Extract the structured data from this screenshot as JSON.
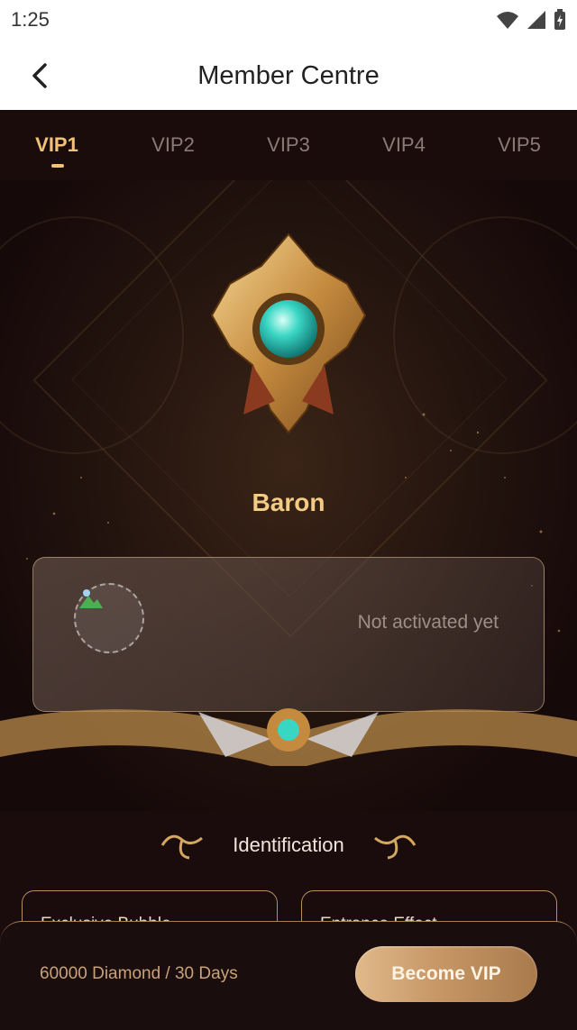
{
  "status_bar": {
    "time": "1:25",
    "icons": [
      "wifi-icon",
      "cellular-signal-icon",
      "battery-charging-icon"
    ]
  },
  "header": {
    "title": "Member Centre",
    "back_icon": "chevron-left-icon"
  },
  "tabs": [
    {
      "label": "VIP1",
      "active": true
    },
    {
      "label": "VIP2",
      "active": false
    },
    {
      "label": "VIP3",
      "active": false
    },
    {
      "label": "VIP4",
      "active": false
    },
    {
      "label": "VIP5",
      "active": false
    }
  ],
  "hero": {
    "level_name": "Baron",
    "badge_icon": "vip-crest-badge-icon"
  },
  "member_card": {
    "status": "Not activated yet",
    "avatar_icon": "broken-image-avatar-icon"
  },
  "identification": {
    "title": "Identification",
    "features": [
      {
        "title": "Exclusive Bubble"
      },
      {
        "title": "Entrance Effect"
      }
    ]
  },
  "purchase": {
    "price": "60000 Diamond / 30 Days",
    "button_label": "Become VIP"
  },
  "colors": {
    "accent_gold": "#f0c278",
    "background": "#1a0c0c",
    "button_gradient_start": "#e0b98b",
    "button_gradient_end": "#a97a4c"
  }
}
